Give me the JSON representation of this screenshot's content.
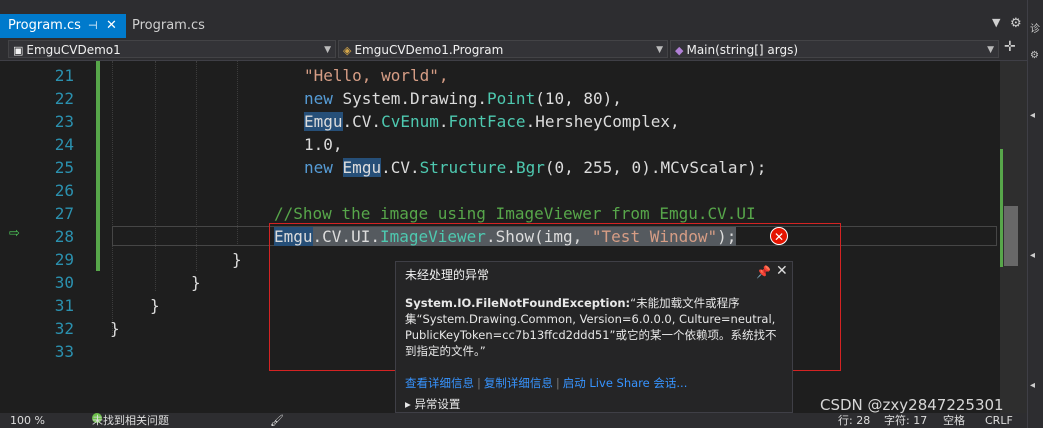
{
  "tabs": [
    {
      "label": "Program.cs",
      "active": true
    },
    {
      "label": "Program.cs",
      "active": false
    }
  ],
  "navbar": {
    "project": "EmguCVDemo1",
    "class": "EmguCVDemo1.Program",
    "member": "Main(string[] args)"
  },
  "editor": {
    "line_numbers": [
      "21",
      "22",
      "23",
      "24",
      "25",
      "26",
      "27",
      "28",
      "29",
      "30",
      "31",
      "32",
      "33"
    ],
    "code": {
      "l21": "\"Hello, world\",",
      "l22_kw": "new",
      "l22_a": " System.Drawing.",
      "l22_ty": "Point",
      "l22_b": "(10, 80),",
      "l23_emgu": "Emgu",
      "l23_a": ".CV.",
      "l23_ty1": "CvEnum",
      "l23_b": ".",
      "l23_ty2": "FontFace",
      "l23_c": ".HersheyComplex,",
      "l24": "1.0,",
      "l25_kw": "new",
      "l25_emgu": "Emgu",
      "l25_a": ".CV.",
      "l25_ty1": "Structure",
      "l25_b": ".",
      "l25_ty2": "Bgr",
      "l25_c": "(0, 255, 0).MCvScalar);",
      "l27": "//Show the image using ImageViewer from Emgu.CV.UI",
      "l28_emgu": "Emgu",
      "l28_a": ".CV.UI.",
      "l28_ty": "ImageViewer",
      "l28_b": ".Show(img, ",
      "l28_str": "\"Test Window\"",
      "l28_c": ");",
      "l29": "}",
      "l30": "}",
      "l31": "}",
      "l32": "}"
    }
  },
  "exception": {
    "title": "未经处理的异常",
    "type": "System.IO.FileNotFoundException:",
    "message": "“未能加载文件或程序集“System.Drawing.Common, Version=6.0.0.0, Culture=neutral, PublicKeyToken=cc7b13ffcd2ddd51”或它的某一个依赖项。系统找不到指定的文件。”",
    "links": [
      "查看详细信息",
      "复制详细信息",
      "启动 Live Share 会话..."
    ],
    "settings": "异常设置"
  },
  "statusbar": {
    "zoom": "100 %",
    "issues": "未找到相关问题",
    "line": "行: 28",
    "char": "字符: 17",
    "space": "空格",
    "eol": "CRLF"
  },
  "watermark": "CSDN @zxy2847225301",
  "colors": {
    "accent": "#007acc",
    "error": "#e51400",
    "keyword": "#569cd6",
    "type": "#4ec9b0",
    "string": "#d69d85",
    "comment": "#57a64a",
    "line_number": "#2b91af"
  }
}
